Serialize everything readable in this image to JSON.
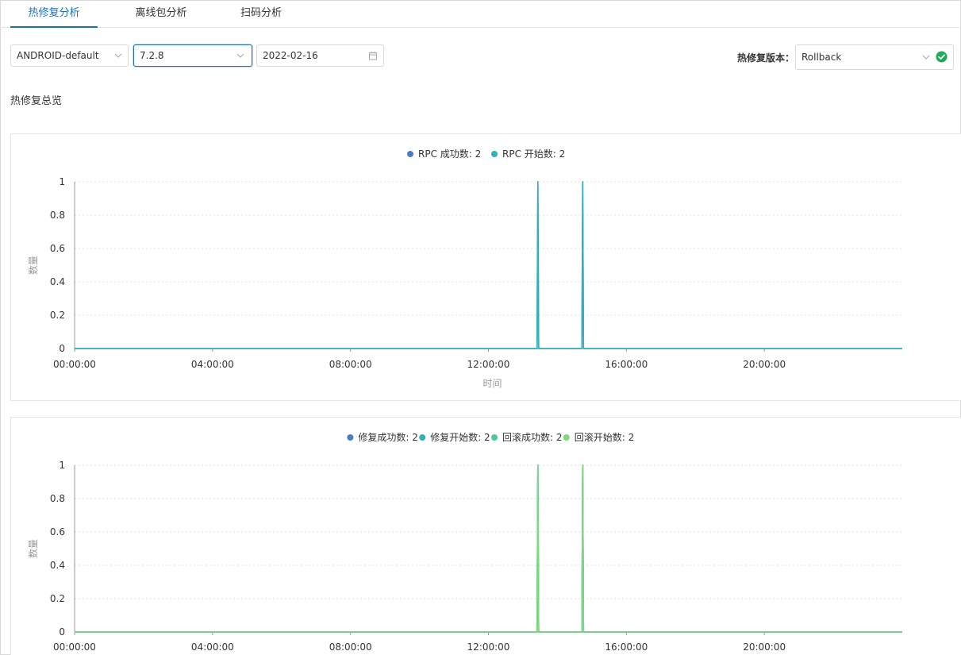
{
  "tabs": [
    {
      "label": "热修复分析",
      "active": true
    },
    {
      "label": "离线包分析",
      "active": false
    },
    {
      "label": "扫码分析",
      "active": false
    }
  ],
  "filters": {
    "platform": "ANDROID-default",
    "version": "7.2.8",
    "date": "2022-02-16",
    "hotfix_version_label": "热修复版本：",
    "hotfix_version": "Rollback"
  },
  "section_title": "热修复总览",
  "colors": {
    "accent": "#1f6fb5",
    "status_ok": "#21a95a",
    "rpc_success": "#4b7bc7",
    "rpc_start": "#30b0b8",
    "fix_success": "#4b7bc7",
    "fix_start": "#30b0b8",
    "rollback_success": "#4ec99a",
    "rollback_start": "#7ed87e"
  },
  "chart_data": [
    {
      "type": "line",
      "xlabel": "时间",
      "ylabel": "数量",
      "x_ticks": [
        "00:00:00",
        "04:00:00",
        "08:00:00",
        "12:00:00",
        "16:00:00",
        "20:00:00"
      ],
      "y_ticks": [
        "0",
        "0.2",
        "0.4",
        "0.6",
        "0.8",
        "1"
      ],
      "xlim": [
        "00:00",
        "24:00"
      ],
      "ylim": [
        0,
        1
      ],
      "grid": true,
      "legend_position": "top-center",
      "series": [
        {
          "name": "RPC 成功数: 2",
          "color": "#4b7bc7",
          "points": [
            [
              "13:26",
              1
            ],
            [
              "14:44",
              1
            ]
          ]
        },
        {
          "name": "RPC 开始数: 2",
          "color": "#30b0b8",
          "points": [
            [
              "13:26",
              1
            ],
            [
              "14:44",
              1
            ]
          ]
        }
      ]
    },
    {
      "type": "line",
      "xlabel": "",
      "ylabel": "数量",
      "x_ticks": [
        "00:00:00",
        "04:00:00",
        "08:00:00",
        "12:00:00",
        "16:00:00",
        "20:00:00"
      ],
      "y_ticks": [
        "0",
        "0.2",
        "0.4",
        "0.6",
        "0.8",
        "1"
      ],
      "xlim": [
        "00:00",
        "24:00"
      ],
      "ylim": [
        0,
        1
      ],
      "grid": true,
      "legend_position": "top-center",
      "series": [
        {
          "name": "修复成功数: 2",
          "color": "#4b7bc7",
          "points": [
            [
              "13:26",
              1
            ],
            [
              "14:44",
              1
            ]
          ]
        },
        {
          "name": "修复开始数: 2",
          "color": "#30b0b8",
          "points": [
            [
              "13:26",
              1
            ],
            [
              "14:44",
              1
            ]
          ]
        },
        {
          "name": "回滚成功数: 2",
          "color": "#4ec99a",
          "points": [
            [
              "13:26",
              1
            ],
            [
              "14:44",
              1
            ]
          ]
        },
        {
          "name": "回滚开始数: 2",
          "color": "#7ed87e",
          "points": [
            [
              "13:26",
              1
            ],
            [
              "14:44",
              1
            ]
          ]
        }
      ]
    }
  ]
}
